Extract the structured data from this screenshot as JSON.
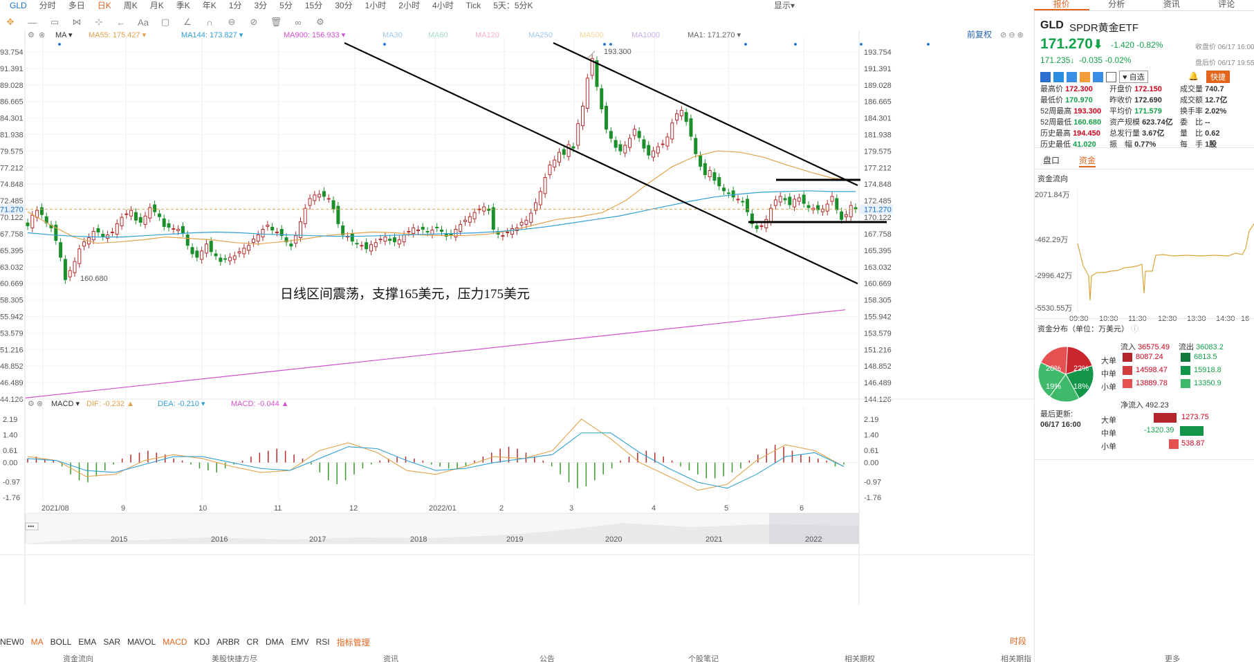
{
  "toolbar": {
    "symbol": "GLD",
    "periods": [
      "分时",
      "多日",
      "日K",
      "周K",
      "月K",
      "季K",
      "年K",
      "1分",
      "3分",
      "5分",
      "15分",
      "30分",
      "1小时",
      "2小时",
      "4小时",
      "Tick",
      "5天：5分K"
    ],
    "active_period": "日K",
    "right_items": [
      "显示"
    ]
  },
  "right_tabs": [
    "报价",
    "分析",
    "资讯",
    "评论"
  ],
  "legend_top": {
    "ma_label": "MA",
    "items": [
      {
        "text": "MA55: 175.427",
        "color": "#e3a24a"
      },
      {
        "text": "MA144: 173.827",
        "color": "#2ea0d6"
      },
      {
        "text": "MA900: 156.933",
        "color": "#d44fcf"
      },
      {
        "text": "MA30",
        "color": "#9fc9ee"
      },
      {
        "text": "MA60",
        "color": "#a6dcc7"
      },
      {
        "text": "MA120",
        "color": "#f3b0cc"
      },
      {
        "text": "MA250",
        "color": "#9fc9ee"
      },
      {
        "text": "MA500",
        "color": "#f5d59a"
      },
      {
        "text": "MA1000",
        "color": "#c6b0e8"
      },
      {
        "text": "MA1: 171.270",
        "color": "#666666"
      }
    ],
    "fuquan": "前复权"
  },
  "price_axis": [
    "193.754",
    "191.391",
    "189.028",
    "186.665",
    "184.301",
    "181.938",
    "179.575",
    "177.212",
    "174.848",
    "172.485",
    "170.122",
    "167.758",
    "165.395",
    "163.032",
    "160.669",
    "158.305",
    "155.942",
    "153.579",
    "151.216",
    "148.852",
    "146.489",
    "144.126"
  ],
  "last_price_tag": "171.270",
  "left_axis_partial": [
    "93.754",
    "91.391",
    "89.028",
    "86.665",
    "84.301",
    "81.938",
    "79.575",
    "77.212",
    "74.848",
    "72.485",
    "70.122",
    "67.758",
    "65.395",
    "63.032",
    "60.669",
    "58.305",
    "55.942",
    "53.579",
    "51.216",
    "48.852",
    "46.489",
    "44.126"
  ],
  "annotations": {
    "high": "193.300",
    "low": "160.680",
    "note": "日线区间震荡，支撑165美元，压力175美元"
  },
  "legend_macd": {
    "name": "MACD",
    "dif": "DIF: -0.232",
    "dea": "DEA: -0.210",
    "macd": "MACD: -0.044"
  },
  "macd_axis": [
    "2.19",
    "1.40",
    "0.61",
    "0.00",
    "-0.97",
    "-1.76"
  ],
  "time_axis": [
    "2021/08",
    "9",
    "10",
    "11",
    "12",
    "2022/01",
    "2",
    "3",
    "4",
    "5",
    "6"
  ],
  "overview_years": [
    "2015",
    "2016",
    "2017",
    "2018",
    "2019",
    "2020",
    "2021",
    "2022"
  ],
  "indicators": [
    "NEW0",
    "MA",
    "BOLL",
    "EMA",
    "SAR",
    "MAVOL",
    "MACD",
    "KDJ",
    "ARBR",
    "CR",
    "DMA",
    "EMV",
    "RSI",
    "指标管理"
  ],
  "indicator_active": [
    "MA",
    "MACD",
    "指标管理"
  ],
  "time_right": "时段",
  "bottom_nav": [
    "资金流向",
    "美股快捷方尽",
    "资讯",
    "公告",
    "个股笔记",
    "相关期权",
    "相关期指",
    "更多"
  ],
  "quote": {
    "code": "GLD",
    "name": "SPDR黄金ETF",
    "price": "171.270",
    "change": "-1.420",
    "pct": "-0.82%",
    "close_label": "收盘价 06/17 16:00",
    "after_price": "171.235",
    "after_change": "-0.035",
    "after_pct": "-0.02%",
    "after_label": "盘后价 06/17 19:55",
    "add_watch": "自选",
    "quick": "快捷",
    "rows": [
      [
        {
          "k": "最高价",
          "v": "172.300",
          "c": "up"
        },
        {
          "k": "开盘价",
          "v": "172.150",
          "c": "up"
        },
        {
          "k": "成交量",
          "v": "740.7",
          "c": "n"
        }
      ],
      [
        {
          "k": "最低价",
          "v": "170.970",
          "c": "dn"
        },
        {
          "k": "昨收价",
          "v": "172.690",
          "c": "n"
        },
        {
          "k": "成交额",
          "v": "12.7亿",
          "c": "n"
        }
      ],
      [
        {
          "k": "52周最高",
          "v": "193.300",
          "c": "up"
        },
        {
          "k": "平均价",
          "v": "171.579",
          "c": "dn"
        },
        {
          "k": "换手率",
          "v": "2.02%",
          "c": "n"
        }
      ],
      [
        {
          "k": "52周最低",
          "v": "160.680",
          "c": "dn"
        },
        {
          "k": "资产规模",
          "v": "623.74亿",
          "c": "n"
        },
        {
          "k": "委　比",
          "v": "--",
          "c": "n"
        }
      ],
      [
        {
          "k": "历史最高",
          "v": "194.450",
          "c": "up"
        },
        {
          "k": "总发行量",
          "v": "3.67亿",
          "c": "n"
        },
        {
          "k": "量　比",
          "v": "0.62",
          "c": "n"
        }
      ],
      [
        {
          "k": "历史最低",
          "v": "41.020",
          "c": "dn"
        },
        {
          "k": "振　幅",
          "v": "0.77%",
          "c": "n"
        },
        {
          "k": "每　手",
          "v": "1股",
          "c": "n"
        }
      ]
    ]
  },
  "subtabs": [
    "盘口",
    "资金"
  ],
  "subtab_active": "资金",
  "flow": {
    "title": "资金流向",
    "y_labels": [
      "2071.84万",
      "-462.29万",
      "-2996.42万",
      "-5530.55万"
    ],
    "x_labels": [
      "09:30",
      "10:30",
      "11:30",
      "12:30",
      "13:30",
      "14:30",
      "16"
    ]
  },
  "distribution": {
    "title": "资金分布（单位：万美元）",
    "inflow_label": "流入",
    "inflow": "36575.49",
    "outflow_label": "流出",
    "outflow": "36083.2",
    "pie": [
      {
        "label": "20%",
        "color": "#c9252c"
      },
      {
        "label": "22%",
        "color": "#14964a"
      },
      {
        "label": "19%",
        "color": "#e55050"
      },
      {
        "label": "18%",
        "color": "#3fba6a"
      }
    ],
    "rows": [
      {
        "name": "大单",
        "in": "8087.24",
        "out": "6813.5"
      },
      {
        "name": "中单",
        "in": "14598.47",
        "out": "15918.8"
      },
      {
        "name": "小单",
        "in": "13889.78",
        "out": "13350.9"
      }
    ],
    "net_label": "净流入",
    "net": "492.23",
    "updated_label": "最后更新:",
    "updated": "06/17 16:00",
    "net_rows": [
      {
        "name": "大单",
        "value": "1273.75",
        "v": 1273.75
      },
      {
        "name": "中单",
        "value": "-1320.39",
        "v": -1320.39
      },
      {
        "name": "小单",
        "value": "538.87",
        "v": 538.87
      }
    ]
  }
}
